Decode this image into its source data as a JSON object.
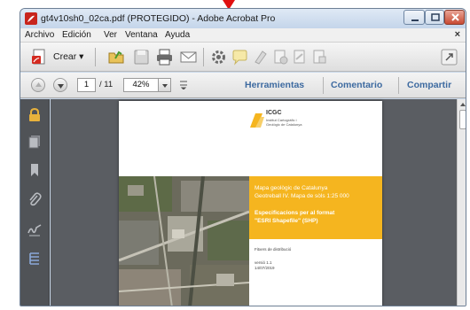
{
  "window": {
    "title": "gt4v10sh0_02ca.pdf (PROTEGIDO) - Adobe Acrobat Pro"
  },
  "menu": {
    "items": [
      "Archivo",
      "Edición",
      "Ver",
      "Ventana",
      "Ayuda"
    ],
    "close_glyph": "×"
  },
  "toolbar": {
    "crear_label": "Crear",
    "icons": [
      "create-pdf-icon",
      "open-folder-icon",
      "save-icon",
      "print-icon",
      "email-icon",
      "gear-icon",
      "comment-bubble-icon",
      "highlight-icon",
      "stamp-icon",
      "sign-icon",
      "share-doc-icon",
      "expand-icon"
    ]
  },
  "nav": {
    "current_page": "1",
    "total_pages": "/ 11",
    "zoom": "42%",
    "panes": [
      "Herramientas",
      "Comentario",
      "Compartir"
    ]
  },
  "rail": {
    "icons": [
      "lock-icon",
      "pages-icon",
      "bookmark-icon",
      "attachment-icon",
      "signature-icon",
      "layers-icon"
    ]
  },
  "document": {
    "logo_name": "ICGC",
    "logo_subtitle": "Institut Cartogràfic i Geològic de Catalunya",
    "title_line1": "Mapa geològic de Catalunya",
    "title_line2": "Geotreball IV. Mapa de sòls 1:25 000",
    "spec_line1": "Especificacions per al format",
    "spec_line2": "\"ESRI Shapefile\" (SHP)",
    "distribution": "Fitxers de distribució",
    "version": "versió 1.1",
    "date": "14/07/2019"
  },
  "colors": {
    "accent_arrow": "#e01010",
    "pane_link": "#3d6aa0",
    "band_yellow": "#f5b51f",
    "doc_background": "#5a5d62"
  }
}
